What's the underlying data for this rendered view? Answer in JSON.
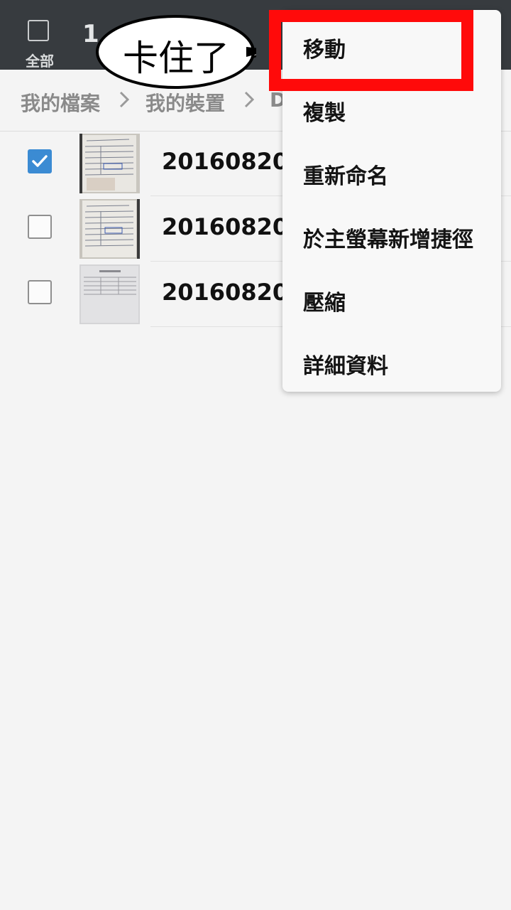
{
  "header": {
    "select_all_label": "全部",
    "selected_count": "1"
  },
  "breadcrumb": {
    "items": [
      "我的檔案",
      "我的裝置",
      "D"
    ]
  },
  "files": [
    {
      "name": "20160820",
      "checked": true
    },
    {
      "name": "20160820",
      "checked": false
    },
    {
      "name": "20160820",
      "checked": false
    }
  ],
  "menu": {
    "items": [
      "移動",
      "複製",
      "重新命名",
      "於主螢幕新增捷徑",
      "壓縮",
      "詳細資料"
    ]
  },
  "annotation": {
    "callout_text": "卡住了"
  },
  "colors": {
    "topbar": "#373b3f",
    "accent": "#3b8bd3",
    "highlight": "#ff0a0a"
  }
}
